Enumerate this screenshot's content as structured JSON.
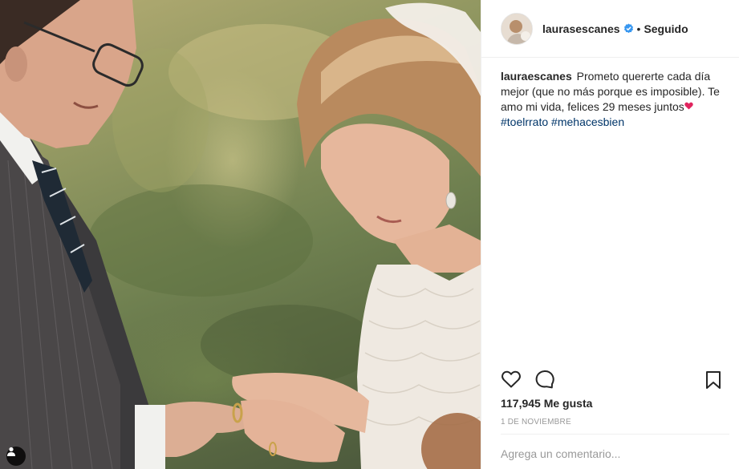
{
  "post": {
    "username": "laurasescanes",
    "follow_separator": "•",
    "follow_status": "Seguido",
    "caption_user": "lauraescanes",
    "caption_text": "Prometo quererte cada día mejor (que no más porque es imposible). Te amo mi vida, felices 29 meses juntos",
    "hashtags": [
      "#toelrrato",
      "#mehacesbien"
    ],
    "likes": "117,945 Me gusta",
    "date": "1 DE NOVIEMBRE",
    "comment_placeholder": "Agrega un comentario..."
  },
  "icons": {
    "verified": "verified-badge-icon",
    "like": "heart-outline-icon",
    "comment": "speech-bubble-icon",
    "save": "bookmark-icon",
    "user_tag": "person-icon",
    "caption_emoji": "red-heart-emoji"
  },
  "colors": {
    "verified_blue": "#3897f0",
    "hashtag": "#003569",
    "muted": "#999999",
    "text": "#262626",
    "emoji_heart": "#e0245e"
  }
}
